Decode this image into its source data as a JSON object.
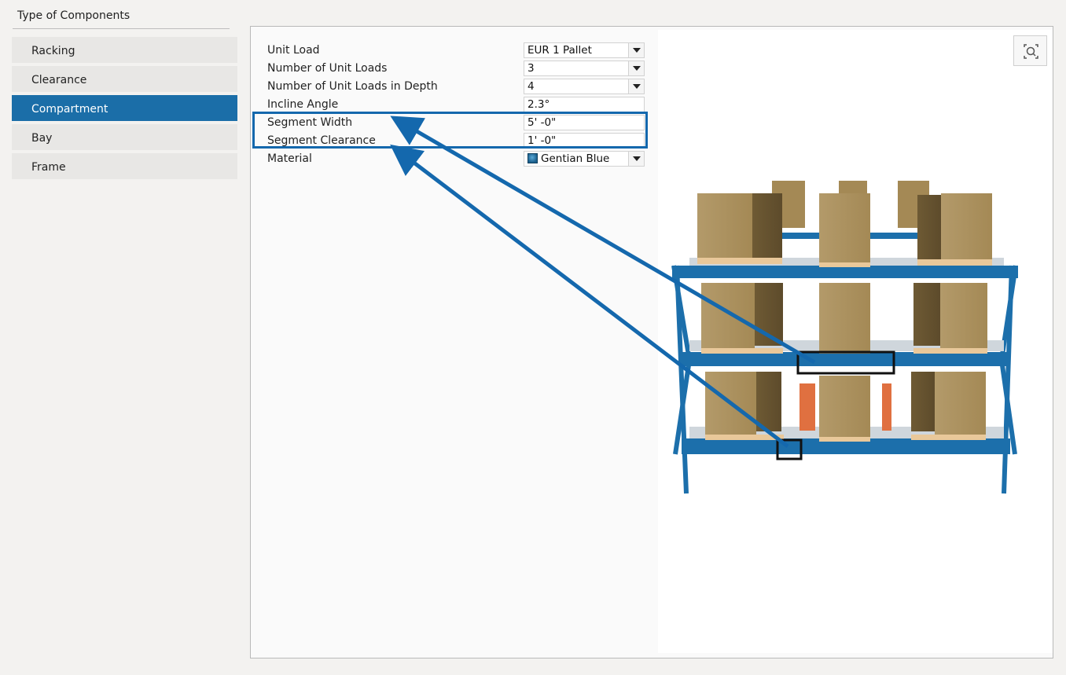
{
  "sidebar": {
    "title": "Type of Components",
    "items": [
      {
        "label": "Racking"
      },
      {
        "label": "Clearance"
      },
      {
        "label": "Compartment"
      },
      {
        "label": "Bay"
      },
      {
        "label": "Frame"
      }
    ],
    "active_index": 2
  },
  "properties": {
    "unit_load": {
      "label": "Unit Load",
      "value": "EUR 1 Pallet"
    },
    "num_unit_loads": {
      "label": "Number of Unit Loads",
      "value": "3"
    },
    "num_unit_loads_depth": {
      "label": "Number of Unit Loads in Depth",
      "value": "4"
    },
    "incline_angle": {
      "label": "Incline Angle",
      "value": "2.3°"
    },
    "segment_width": {
      "label": "Segment Width",
      "value": "5' -0\""
    },
    "segment_clearance": {
      "label": "Segment Clearance",
      "value": "1' -0\""
    },
    "material": {
      "label": "Material",
      "value": "Gentian Blue"
    }
  },
  "viewer": {
    "zoom_button_icon": "zoom-fit-icon"
  },
  "colors": {
    "accent": "#1b6ea8",
    "annotation": "#1468ad",
    "rack_blue": "#1c6fab",
    "box": "#a88d5c"
  }
}
